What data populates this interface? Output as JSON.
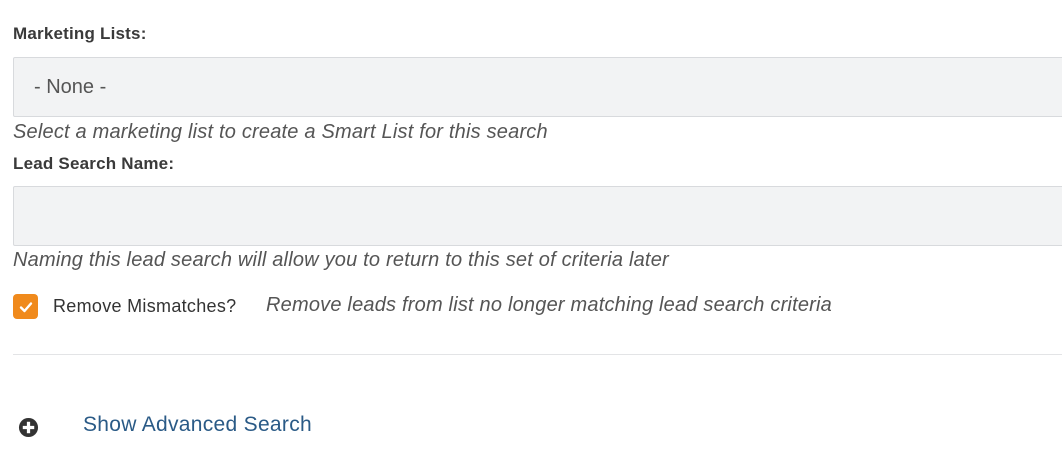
{
  "marketing_lists": {
    "label": "Marketing Lists:",
    "selected": "- None -",
    "help": "Select a marketing list to create a Smart List for this search"
  },
  "lead_search_name": {
    "label": "Lead Search Name:",
    "value": "",
    "help": "Naming this lead search will allow you to return to this set of criteria later"
  },
  "remove_mismatches": {
    "label": "Remove Mismatches?",
    "checked": true,
    "help": "Remove leads from list no longer matching lead search criteria"
  },
  "advanced": {
    "icon": "plus-circle-icon",
    "label": "Show Advanced Search"
  },
  "colors": {
    "accent": "#f08a1c",
    "link": "#2a5a86",
    "field_bg": "#f2f3f4"
  }
}
